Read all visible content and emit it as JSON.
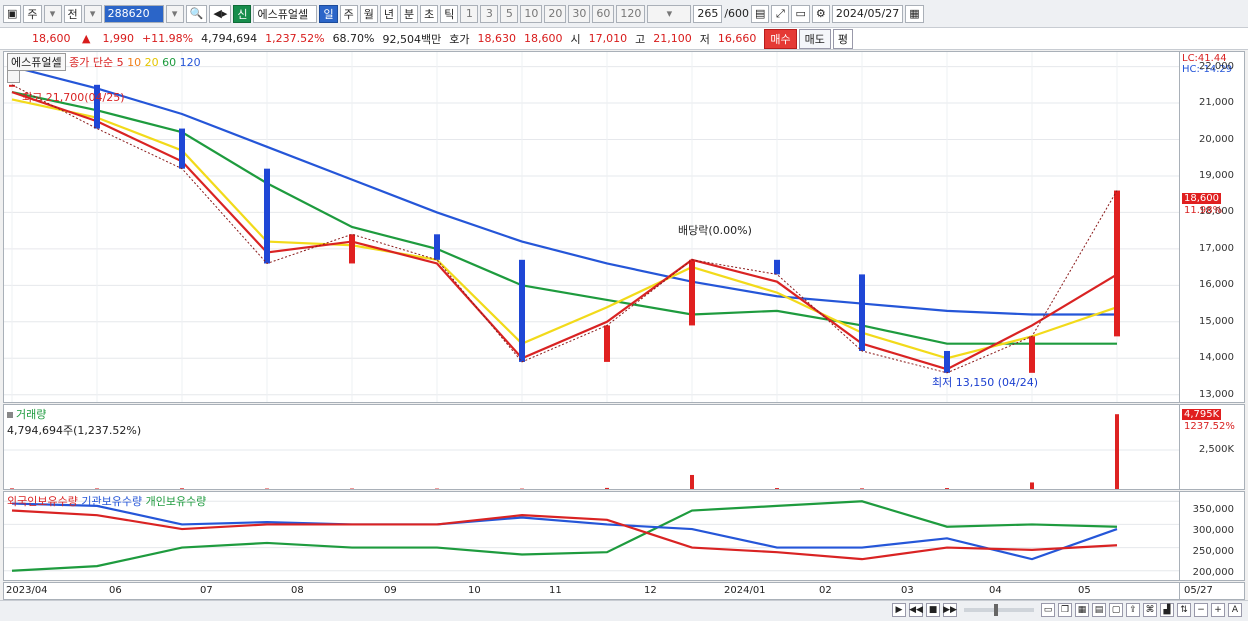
{
  "toolbar": {
    "period_main": "주",
    "period_ref": "전",
    "code": "288620",
    "badge": "신",
    "name": "에스퓨얼셀",
    "periods": [
      "일",
      "주",
      "월",
      "년",
      "분",
      "초",
      "틱"
    ],
    "intervals": [
      "1",
      "3",
      "5",
      "10",
      "20",
      "30",
      "60",
      "120"
    ],
    "count": "265",
    "count_total": "/600",
    "date": "2024/05/27"
  },
  "quote": {
    "price": "18,600",
    "arrow": "▲",
    "change": "1,990",
    "rate": "+11.98%",
    "volume": "4,794,694",
    "vol_rate": "1,237.52%",
    "turnover": "68.70%",
    "amount": "92,504백만",
    "ask_label": "호가",
    "ask": "18,630",
    "bid": "18,600",
    "open_label": "시",
    "open": "17,010",
    "high_label": "고",
    "high": "21,100",
    "low_label": "저",
    "low": "16,660",
    "buy_label": "매수",
    "sell_label": "매도",
    "eq_label": "평"
  },
  "price_panel": {
    "name_box": "에스퓨얼셀",
    "legend_text": "종가 단순",
    "ma": [
      "5",
      "10",
      "20",
      "60",
      "120"
    ],
    "ma_colors": [
      "#d92323",
      "#f0801a",
      "#f2da1a",
      "#1e9b3e",
      "#2556d8"
    ],
    "hi_note": "최고 21,700(04/25)",
    "lo_note": "최저 13,150 (04/24)",
    "div_note": "배당락(0.00%)",
    "lc": "LC:41.44",
    "hc": "HC:-14.29",
    "price_tag": "18,600",
    "rate_tag": "11.98%",
    "yticks": [
      "22,000",
      "21,000",
      "20,000",
      "19,000",
      "18,000",
      "17,000",
      "16,000",
      "15,000",
      "14,000",
      "13,000"
    ]
  },
  "volume_panel": {
    "title": "거래량",
    "value": "4,794,694주(1,237.52%)",
    "tag": "4,795K",
    "tag2": "1237.52%",
    "yticks": [
      "2,500K"
    ]
  },
  "holdings_panel": {
    "series": [
      {
        "name": "외국인보유수량",
        "color": "#d92323"
      },
      {
        "name": "기관보유수량",
        "color": "#2556d8"
      },
      {
        "name": "개인보유수량",
        "color": "#1e9b3e"
      }
    ],
    "yticks": [
      "350,000",
      "300,000",
      "250,000",
      "200,000"
    ]
  },
  "xaxis": {
    "labels": [
      "2023/04",
      "06",
      "07",
      "08",
      "09",
      "10",
      "11",
      "12",
      "2024/01",
      "02",
      "03",
      "04",
      "05"
    ],
    "right": "05/27"
  },
  "chart_data": {
    "type": "line",
    "price_x": [
      "2023/04",
      "06",
      "07",
      "08",
      "09",
      "10",
      "11",
      "12",
      "2024/01",
      "02",
      "03",
      "04",
      "05",
      "05/27"
    ],
    "close": [
      21500,
      20300,
      19200,
      16600,
      17400,
      16700,
      13900,
      14900,
      16700,
      16300,
      14200,
      13600,
      14600,
      18600
    ],
    "ma5": [
      21300,
      20500,
      19400,
      16900,
      17200,
      16600,
      14000,
      15000,
      16700,
      16100,
      14400,
      13700,
      14900,
      16300
    ],
    "ma20": [
      21100,
      20600,
      19700,
      17200,
      17100,
      16700,
      14400,
      15400,
      16500,
      15800,
      14700,
      14000,
      14600,
      15400
    ],
    "ma60": [
      21300,
      20800,
      20200,
      18800,
      17600,
      17000,
      16000,
      15600,
      15200,
      15300,
      14900,
      14400,
      14400,
      14400
    ],
    "ma120": [
      22000,
      21400,
      20700,
      19800,
      18900,
      18000,
      17200,
      16600,
      16100,
      15700,
      15500,
      15300,
      15200,
      15200
    ],
    "volume": [
      40,
      35,
      45,
      30,
      30,
      28,
      25,
      70,
      900,
      60,
      40,
      60,
      420,
      4795
    ],
    "foreign": [
      330,
      320,
      290,
      300,
      300,
      300,
      320,
      310,
      250,
      240,
      225,
      250,
      245,
      255
    ],
    "institution": [
      345,
      340,
      300,
      305,
      300,
      300,
      315,
      300,
      290,
      250,
      250,
      270,
      225,
      290
    ],
    "individual": [
      200,
      210,
      250,
      260,
      250,
      250,
      235,
      240,
      330,
      340,
      350,
      295,
      300,
      295
    ],
    "ylim_price": [
      12800,
      22400
    ],
    "ylim_volume": [
      0,
      5000
    ],
    "ylim_holdings": [
      180,
      370
    ]
  }
}
